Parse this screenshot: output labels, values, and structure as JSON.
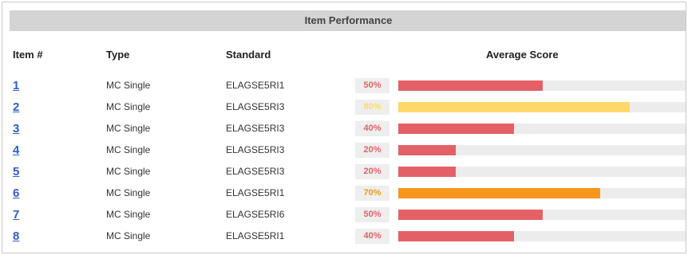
{
  "panel": {
    "title": "Item Performance"
  },
  "headers": {
    "item": "Item #",
    "type": "Type",
    "standard": "Standard",
    "score": "Average Score"
  },
  "colors": {
    "low": "#e36166",
    "mid": "#ffd86b",
    "orange": "#f7961d",
    "low_text": "#e36166",
    "mid_text": "#ffd86b",
    "orange_text": "#f7961d"
  },
  "rows": [
    {
      "item": "1",
      "type": "MC Single",
      "standard": "ELAGSE5RI1",
      "score_label": "50%",
      "score": 0.5,
      "band": "low"
    },
    {
      "item": "2",
      "type": "MC Single",
      "standard": "ELAGSE5RI3",
      "score_label": "80%",
      "score": 0.8,
      "band": "mid"
    },
    {
      "item": "3",
      "type": "MC Single",
      "standard": "ELAGSE5RI3",
      "score_label": "40%",
      "score": 0.4,
      "band": "low"
    },
    {
      "item": "4",
      "type": "MC Single",
      "standard": "ELAGSE5RI3",
      "score_label": "20%",
      "score": 0.2,
      "band": "low"
    },
    {
      "item": "5",
      "type": "MC Single",
      "standard": "ELAGSE5RI3",
      "score_label": "20%",
      "score": 0.2,
      "band": "low"
    },
    {
      "item": "6",
      "type": "MC Single",
      "standard": "ELAGSE5RI1",
      "score_label": "70%",
      "score": 0.7,
      "band": "orange"
    },
    {
      "item": "7",
      "type": "MC Single",
      "standard": "ELAGSE5RI6",
      "score_label": "50%",
      "score": 0.5,
      "band": "low"
    },
    {
      "item": "8",
      "type": "MC Single",
      "standard": "ELAGSE5RI1",
      "score_label": "40%",
      "score": 0.4,
      "band": "low"
    }
  ]
}
